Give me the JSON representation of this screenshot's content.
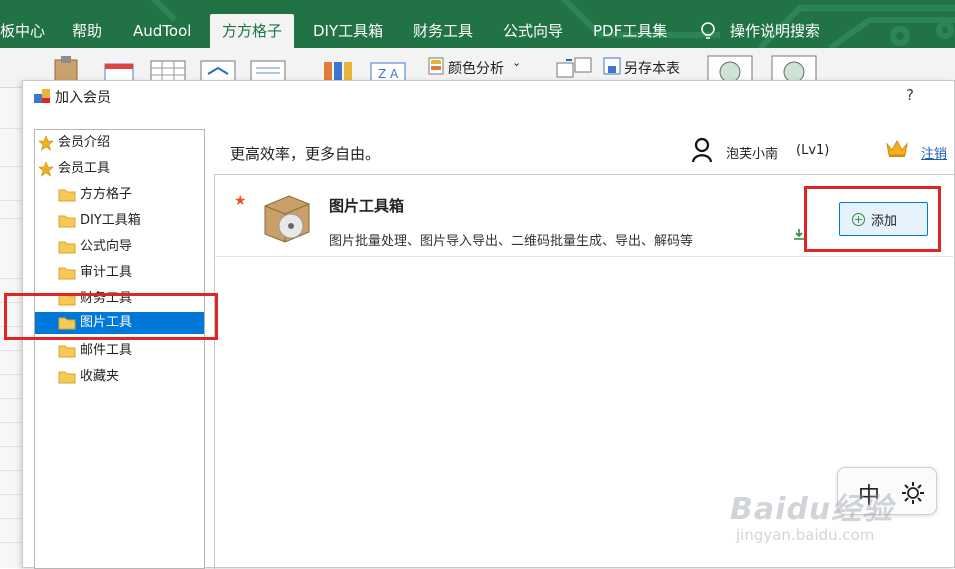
{
  "ribbon_tabs": [
    {
      "label": "板中心"
    },
    {
      "label": "帮助"
    },
    {
      "label": "AudTool"
    },
    {
      "label": "方方格子"
    },
    {
      "label": "DIY工具箱"
    },
    {
      "label": "财务工具"
    },
    {
      "label": "公式向导"
    },
    {
      "label": "PDF工具集"
    },
    {
      "label": "操作说明搜索"
    }
  ],
  "ribbon": {
    "color_analysis": "颜色分析",
    "save_as_sheet": "另存本表"
  },
  "dialog": {
    "title": "加入会员",
    "help": "?"
  },
  "tree": [
    {
      "label": "会员介绍",
      "icon": "star-icon"
    },
    {
      "label": "会员工具",
      "icon": "star-icon"
    },
    {
      "label": "方方格子",
      "icon": "folder-icon"
    },
    {
      "label": "DIY工具箱",
      "icon": "folder-icon"
    },
    {
      "label": "公式向导",
      "icon": "folder-icon"
    },
    {
      "label": "审计工具",
      "icon": "folder-icon"
    },
    {
      "label": "财务工具",
      "icon": "folder-icon"
    },
    {
      "label": "图片工具",
      "icon": "folder-icon",
      "selected": true
    },
    {
      "label": "邮件工具",
      "icon": "folder-icon"
    },
    {
      "label": "收藏夹",
      "icon": "folder-icon"
    }
  ],
  "header": {
    "slogan": "更高效率，更多自由。",
    "user_name": "泡芙小南",
    "user_level": "(Lv1)",
    "logout": "注销"
  },
  "tool": {
    "name": "图片工具箱",
    "description": "图片批量处理、图片导入导出、二维码批量生成、导出、解码等",
    "add_label": "添加"
  },
  "ime": {
    "mode": "中"
  },
  "watermark": {
    "brand": "Baidu经验",
    "url": "jingyan.baidu.com"
  },
  "colors": {
    "excel_green": "#217346",
    "selection_blue": "#0078d7",
    "highlight_red": "#e02525",
    "star_orange": "#e8561b"
  }
}
